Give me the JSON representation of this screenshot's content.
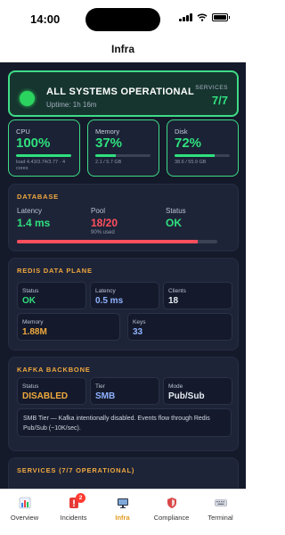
{
  "status_bar": {
    "time": "14:00"
  },
  "nav": {
    "title": "Infra"
  },
  "banner": {
    "title": "ALL SYSTEMS OPERATIONAL",
    "uptime": "Uptime: 1h 16m",
    "services_label": "SERVICES",
    "services_value": "7/7"
  },
  "metrics": [
    {
      "label": "CPU",
      "value": "100%",
      "sub": "load 4.43/3.74/3.77 · 4 cores",
      "fill": 1.0
    },
    {
      "label": "Memory",
      "value": "37%",
      "sub": "2.1 / 5.7 GB",
      "fill": 0.37
    },
    {
      "label": "Disk",
      "value": "72%",
      "sub": "38.6 / 55.9 GB",
      "fill": 0.72
    }
  ],
  "database": {
    "title": "DATABASE",
    "latency_label": "Latency",
    "latency_value": "1.4 ms",
    "pool_label": "Pool",
    "pool_value": "18/20",
    "pool_sub": "90% used",
    "status_label": "Status",
    "status_value": "OK",
    "pool_fill": 0.9
  },
  "redis": {
    "title": "REDIS DATA PLANE",
    "status_label": "Status",
    "status_value": "OK",
    "latency_label": "Latency",
    "latency_value": "0.5 ms",
    "clients_label": "Clients",
    "clients_value": "18",
    "memory_label": "Memory",
    "memory_value": "1.88M",
    "keys_label": "Keys",
    "keys_value": "33"
  },
  "kafka": {
    "title": "KAFKA BACKBONE",
    "status_label": "Status",
    "status_value": "DISABLED",
    "tier_label": "Tier",
    "tier_value": "SMB",
    "mode_label": "Mode",
    "mode_value": "Pub/Sub",
    "note": "SMB Tier — Kafka intentionally disabled. Events flow through Redis Pub/Sub (~10K/sec)."
  },
  "services": {
    "title": "SERVICES (7/7 OPERATIONAL)"
  },
  "tabs": [
    {
      "label": "Overview",
      "icon": "chart-icon"
    },
    {
      "label": "Incidents",
      "icon": "alert-icon",
      "badge": "2"
    },
    {
      "label": "Infra",
      "icon": "monitor-icon",
      "active": true
    },
    {
      "label": "Compliance",
      "icon": "shield-icon"
    },
    {
      "label": "Terminal",
      "icon": "keyboard-icon"
    }
  ],
  "colors": {
    "background": "#151a2b",
    "ok": "#2fe07e",
    "warning": "#f0a93e",
    "danger": "#ff4f5e",
    "info": "#8fb2ff",
    "accent_tab": "#e39a1f"
  }
}
